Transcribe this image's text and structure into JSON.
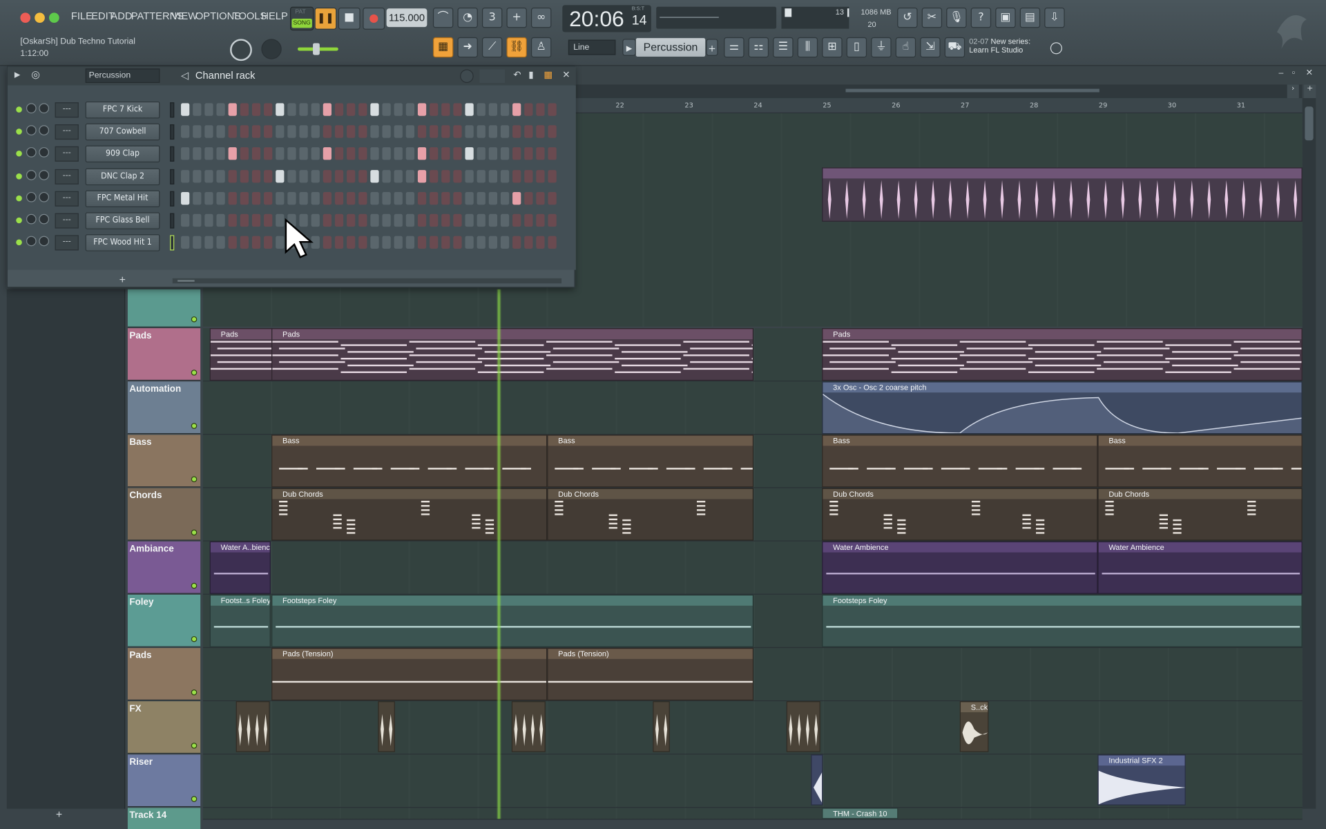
{
  "menu": [
    "FILE",
    "EDIT",
    "ADD",
    "PATTERNS",
    "VIEW",
    "OPTIONS",
    "TOOLS",
    "HELP"
  ],
  "transport": {
    "mode_top": "PAT",
    "mode": "SONG",
    "tempo": "115.000",
    "time_main": "20:06",
    "time_sub": "14",
    "time_label": "B:S:T"
  },
  "status": {
    "cpu_val": "13",
    "ram": "1086 MB",
    "poly": "20"
  },
  "project": {
    "name": "[OskarSh] Dub Techno Tutorial",
    "time": "1:12:00"
  },
  "snap": "Line",
  "pattern": "Percussion",
  "news": {
    "date": "02-07",
    "line1": "New series:",
    "line2": "Learn FL Studio"
  },
  "rack": {
    "filter": "Percussion",
    "title": "Channel rack",
    "add": "+"
  },
  "channels": [
    {
      "name": "FPC 7 Kick",
      "route": "---",
      "steps": [
        1,
        0,
        0,
        0,
        2,
        0,
        0,
        0,
        1,
        0,
        0,
        0,
        2,
        0,
        0,
        0,
        1,
        0,
        0,
        0,
        2,
        0,
        0,
        0,
        1,
        0,
        0,
        0,
        2,
        0,
        0,
        0
      ]
    },
    {
      "name": "707 Cowbell",
      "route": "---",
      "steps": [
        0,
        0,
        0,
        0,
        0,
        0,
        0,
        0,
        0,
        0,
        0,
        0,
        0,
        0,
        0,
        0,
        0,
        0,
        0,
        0,
        0,
        0,
        0,
        0,
        0,
        0,
        0,
        0,
        0,
        0,
        0,
        0
      ]
    },
    {
      "name": "909 Clap",
      "route": "---",
      "steps": [
        0,
        0,
        0,
        0,
        2,
        0,
        0,
        0,
        0,
        0,
        0,
        0,
        2,
        0,
        0,
        0,
        0,
        0,
        0,
        0,
        2,
        0,
        0,
        0,
        1,
        0,
        0,
        0,
        0,
        0,
        0,
        0
      ]
    },
    {
      "name": "DNC Clap 2",
      "route": "---",
      "steps": [
        0,
        0,
        0,
        0,
        0,
        0,
        0,
        0,
        1,
        0,
        0,
        0,
        0,
        0,
        0,
        0,
        1,
        0,
        0,
        0,
        2,
        0,
        0,
        0,
        0,
        0,
        0,
        0,
        0,
        0,
        0,
        0
      ]
    },
    {
      "name": "FPC Metal Hit",
      "route": "---",
      "steps": [
        1,
        0,
        0,
        0,
        0,
        0,
        0,
        0,
        0,
        0,
        0,
        0,
        0,
        0,
        0,
        0,
        0,
        0,
        0,
        0,
        0,
        0,
        0,
        0,
        0,
        0,
        0,
        0,
        2,
        0,
        0,
        0
      ]
    },
    {
      "name": "FPC Glass Bell",
      "route": "---",
      "steps": [
        0,
        0,
        0,
        0,
        0,
        0,
        0,
        0,
        0,
        0,
        0,
        0,
        0,
        0,
        0,
        0,
        0,
        0,
        0,
        0,
        0,
        0,
        0,
        0,
        0,
        0,
        0,
        0,
        0,
        0,
        0,
        0
      ]
    },
    {
      "name": "FPC Wood Hit 1",
      "route": "---",
      "steps": [
        0,
        0,
        0,
        0,
        0,
        0,
        0,
        0,
        0,
        0,
        0,
        0,
        0,
        0,
        0,
        0,
        0,
        0,
        0,
        0,
        0,
        0,
        0,
        0,
        0,
        0,
        0,
        0,
        0,
        0,
        0,
        0
      ]
    }
  ],
  "ruler": [
    "22",
    "23",
    "24",
    "25",
    "26",
    "27",
    "28",
    "29",
    "30",
    "31"
  ],
  "tracks": [
    {
      "name": "",
      "color": "#5b9a8f"
    },
    {
      "name": "Pads",
      "color": "#b06f8b"
    },
    {
      "name": "Automation",
      "color": "#6d7f92"
    },
    {
      "name": "Bass",
      "color": "#8a7560"
    },
    {
      "name": "Chords",
      "color": "#7b6a58"
    },
    {
      "name": "Ambiance",
      "color": "#7a5a94"
    },
    {
      "name": "Foley",
      "color": "#5c9c94"
    },
    {
      "name": "Pads",
      "color": "#8c7660"
    },
    {
      "name": "FX",
      "color": "#8e8265"
    },
    {
      "name": "Riser",
      "color": "#6d7aa0"
    },
    {
      "name": "Track 14",
      "color": "#5d9a8c"
    }
  ],
  "clips": {
    "pads": [
      "Pads",
      "Pads",
      "Pads"
    ],
    "automation": "3x Osc - Osc 2 coarse pitch",
    "bass": [
      "Bass",
      "Bass",
      "Bass",
      "Bass"
    ],
    "chords": [
      "Dub Chords",
      "Dub Chords",
      "Dub Chords",
      "Dub Chords"
    ],
    "ambiance": [
      "Water A..bience",
      "Water Ambience",
      "Water Ambience"
    ],
    "foley": [
      "Footst..s Foley",
      "Footsteps Foley",
      "Footsteps Foley"
    ],
    "pads_tension": [
      "Pads (Tension)",
      "Pads (Tension)"
    ],
    "fx": [
      "S..ck"
    ],
    "riser": [
      "Industrial SFX 2"
    ],
    "track14": [
      "THM - Crash 10"
    ]
  },
  "add_track": "+"
}
